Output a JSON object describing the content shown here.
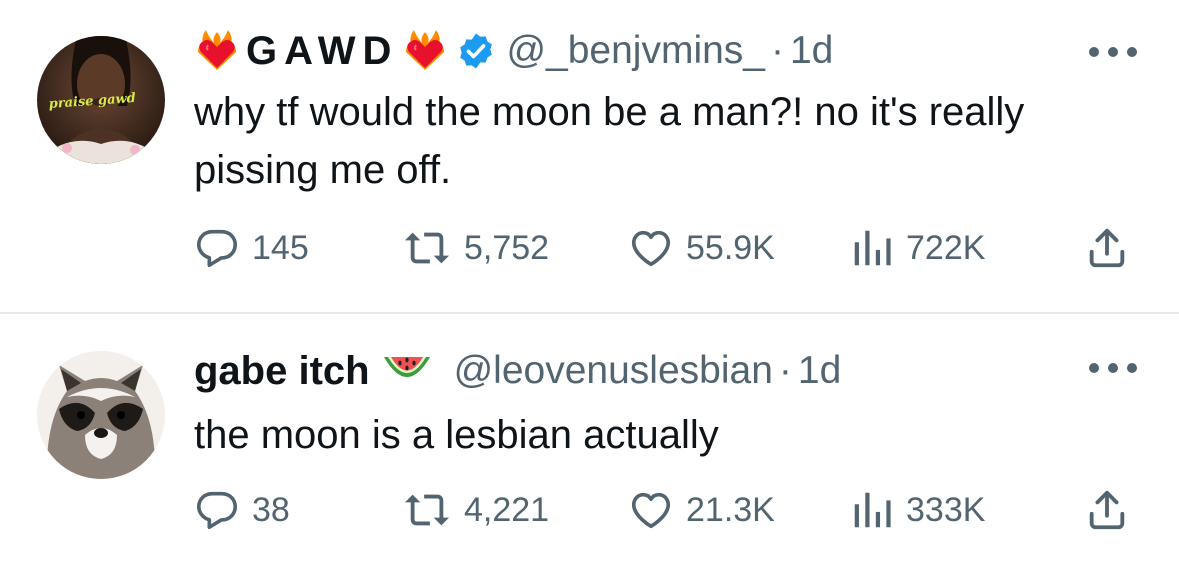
{
  "tweets": [
    {
      "display_name": "GAWD",
      "name_emoji_left": "heart-on-fire",
      "name_emoji_right": "heart-on-fire",
      "verified": true,
      "handle": "@_benjvmins_",
      "separator": "·",
      "time": "1d",
      "avatar_text": "praise gawd",
      "text": "why tf would the moon be a man?! no it's really pissing me off.",
      "stats": {
        "replies": "145",
        "retweets": "5,752",
        "likes": "55.9K",
        "views": "722K"
      }
    },
    {
      "display_name": "gabe itch",
      "name_emoji": "watermelon",
      "verified": false,
      "handle": "@leovenuslesbian",
      "separator": "·",
      "time": "1d",
      "avatar_subject": "raccoon",
      "text": "the moon is a lesbian actually",
      "stats": {
        "replies": "38",
        "retweets": "4,221",
        "likes": "21.3K",
        "views": "333K"
      }
    }
  ],
  "colors": {
    "text": "#0f1419",
    "secondary": "#536471",
    "verified": "#1d9bf0",
    "divider": "#e6e9eb"
  },
  "icons": [
    "reply-icon",
    "retweet-icon",
    "like-icon",
    "views-icon",
    "share-icon",
    "more-icon",
    "verified-badge-icon"
  ]
}
